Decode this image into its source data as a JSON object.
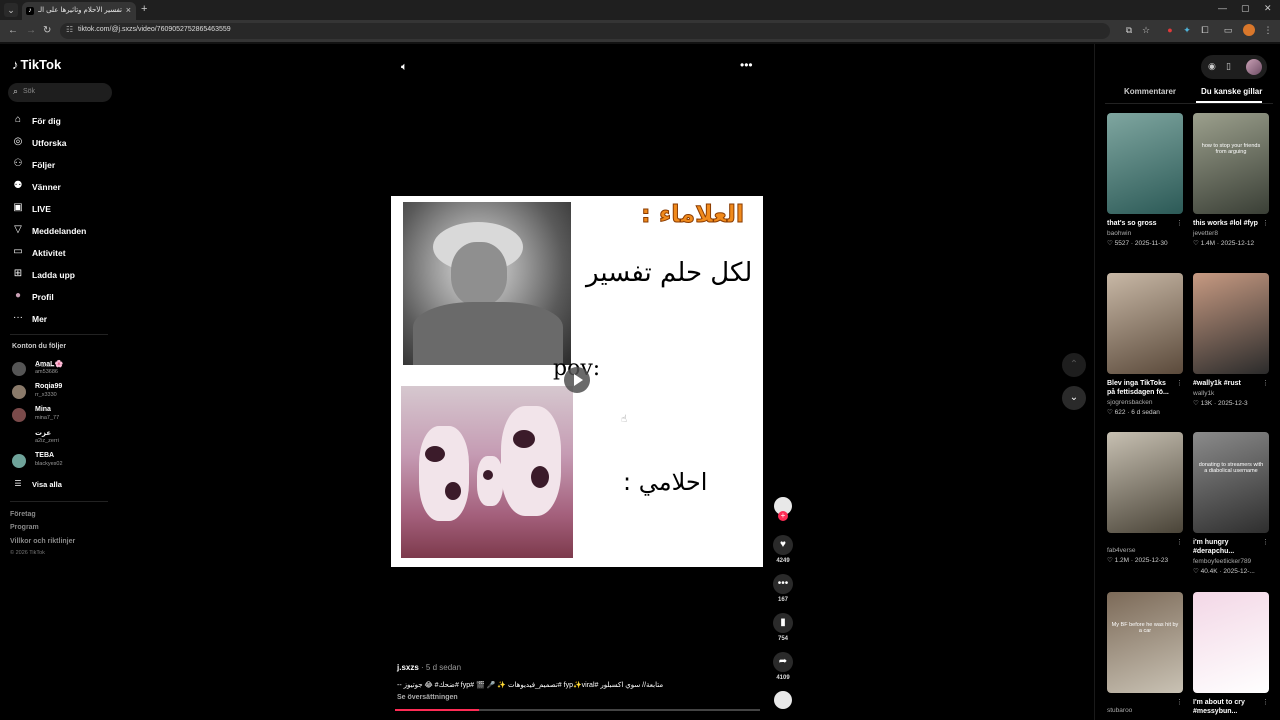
{
  "browser": {
    "tab_title": "تفسير الأحلام وتأثيرها على الـ",
    "tab_close": "×",
    "new_tab": "+",
    "url": "tiktok.com/@j.sxzs/video/7609052752865463559"
  },
  "sidebar": {
    "logo": "TikTok",
    "search_placeholder": "Sök",
    "nav": [
      {
        "label": "För dig",
        "icon": "home-icon",
        "glyph": "⌂"
      },
      {
        "label": "Utforska",
        "icon": "compass-icon",
        "glyph": "◎"
      },
      {
        "label": "Följer",
        "icon": "user-plus-icon",
        "glyph": "⚇"
      },
      {
        "label": "Vänner",
        "icon": "friends-icon",
        "glyph": "⚉"
      },
      {
        "label": "LIVE",
        "icon": "live-icon",
        "glyph": "▣"
      },
      {
        "label": "Meddelanden",
        "icon": "inbox-icon",
        "glyph": "▽"
      },
      {
        "label": "Aktivitet",
        "icon": "activity-icon",
        "glyph": "▭"
      },
      {
        "label": "Ladda upp",
        "icon": "upload-icon",
        "glyph": "⊞"
      },
      {
        "label": "Profil",
        "icon": "profile-icon",
        "glyph": "●"
      },
      {
        "label": "Mer",
        "icon": "more-icon",
        "glyph": "···"
      }
    ],
    "following_title": "Konton du följer",
    "accounts": [
      {
        "name": "A̲m̲a̲L̲🌸",
        "handle": "am53686",
        "color": "#555"
      },
      {
        "name": "Roqia99",
        "handle": "rr_x3330",
        "color": "#8a7a6a"
      },
      {
        "name": "Mina",
        "handle": "mina7_77",
        "color": "#7a4a4a"
      },
      {
        "name": "عزت",
        "handle": "a2iz_zerri",
        "color": "#000"
      },
      {
        "name": "TEBA",
        "handle": "blackyes02",
        "color": "#6fa39a"
      }
    ],
    "show_all": "Visa alla",
    "footer": [
      "Företag",
      "Program",
      "Villkor och riktlinjer"
    ],
    "copyright": "© 2026 TikTok"
  },
  "video": {
    "overlay_title": "العلاماء :",
    "overlay_line2": "لكل حلم تفسير",
    "overlay_pov": "pov:",
    "overlay_line3": "احلامي :",
    "progress": 0.23
  },
  "actions": {
    "likes": "4249",
    "comments": "167",
    "saves": "754",
    "shares": "4109"
  },
  "caption": {
    "user": "j.sxzs",
    "date": " · 5 d sedan",
    "text": "-- ضحك# 😂 جوتيوز# fyp# 🎬 🎤 ✨ تصميم_فيديوهات# fyp✨viral# متابعة// سوي اكسبلور",
    "see_translation": "Se översättningen"
  },
  "right_panel": {
    "tab_comments": "Kommentarer",
    "tab_suggested": "Du kanske gillar",
    "cards": [
      {
        "title": "that's so gross",
        "author": "baohwin",
        "likes": "5527",
        "date": "2025-11-30",
        "thumb_text": "",
        "colors": [
          "#2c5a57",
          "#7fa6a0"
        ]
      },
      {
        "title": "this works #lol #fyp",
        "author": "jevetter8",
        "likes": "1.4M",
        "date": "2025-12-12",
        "thumb_text": "how to stop your friends from arguing",
        "colors": [
          "#3a3f36",
          "#9ca08d"
        ]
      },
      {
        "title": "Blev inga TikToks på fettisdagen fö...",
        "author": "sjogrensbacken",
        "likes": "622",
        "date": "6 d sedan",
        "thumb_text": "",
        "colors": [
          "#5b4a3b",
          "#c8b8a6"
        ]
      },
      {
        "title": "#wally1k #rust",
        "author": "wally1k",
        "likes": "13K",
        "date": "2025-12-3",
        "thumb_text": "",
        "colors": [
          "#2b2b2b",
          "#c79a82"
        ]
      },
      {
        "title": "",
        "author": "fab4verse",
        "likes": "1.2M",
        "date": "2025-12-23",
        "thumb_text": "",
        "colors": [
          "#4a4438",
          "#c7c0b2"
        ]
      },
      {
        "title": "i'm hungry #derapchu...",
        "author": "femboyfeetlicker789",
        "likes": "40.4K",
        "date": "2025-12-...",
        "thumb_text": "donating to streamers with a diabolical username",
        "colors": [
          "#2e2e2e",
          "#8b8b8b"
        ]
      },
      {
        "title": "",
        "author": "stubaroo",
        "likes": "",
        "date": "",
        "thumb_text": "My BF before he was hit by a car",
        "colors": [
          "#c9c2b4",
          "#7c6a58"
        ]
      },
      {
        "title": "I'm about to cry #messybun...",
        "author": "",
        "likes": "",
        "date": "",
        "thumb_text": "",
        "colors": [
          "#ffffff",
          "#f3d7e6"
        ]
      }
    ]
  }
}
